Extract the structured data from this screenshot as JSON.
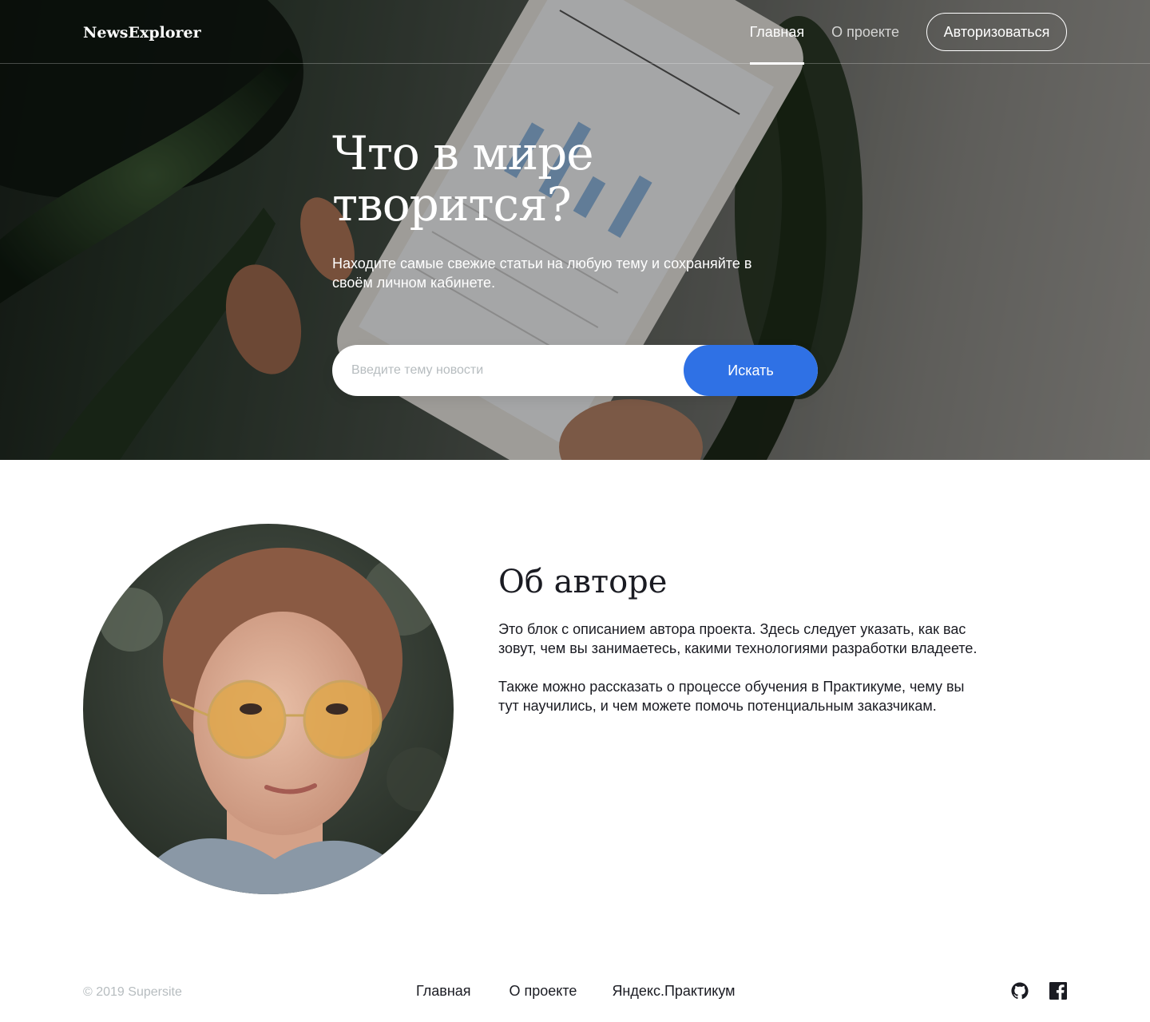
{
  "header": {
    "logo": "NewsExplorer",
    "nav": [
      {
        "label": "Главная",
        "active": true
      },
      {
        "label": "О проекте",
        "active": false
      }
    ],
    "auth_label": "Авторизоваться"
  },
  "hero": {
    "title": "Что в мире творится?",
    "subtitle": "Находите самые свежие статьи на любую тему и сохраняйте в своём личном кабинете.",
    "search_placeholder": "Введите тему новости",
    "search_button": "Искать"
  },
  "about": {
    "title": "Об авторе",
    "paragraphs": [
      "Это блок с описанием автора проекта. Здесь следует указать, как вас зовут, чем вы занимаетесь, какими технологиями разработки владеете.",
      "Также можно рассказать о процессе обучения в Практикуме, чему вы тут научились, и чем можете помочь потенциальным заказчикам."
    ]
  },
  "footer": {
    "copyright": "© 2019  Supersite",
    "links": [
      "Главная",
      "О проекте",
      "Яндекс.Практикум"
    ],
    "socials": [
      "github-icon",
      "facebook-icon"
    ]
  },
  "colors": {
    "accent": "#2f71e5",
    "text": "#1a1b22",
    "muted": "#b6bcbf"
  }
}
